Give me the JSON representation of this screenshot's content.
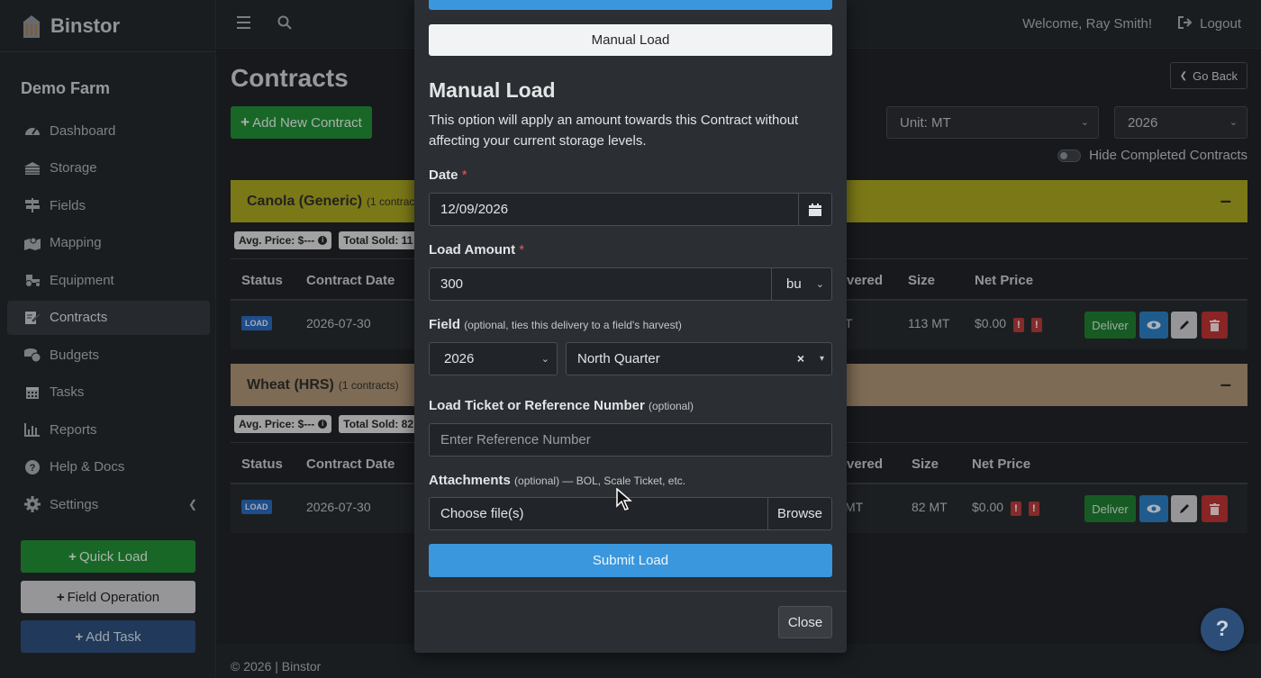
{
  "brand": {
    "name": "Binstor"
  },
  "farm_name": "Demo Farm",
  "sidebar": {
    "items": [
      {
        "label": "Dashboard",
        "icon": "gauge-icon"
      },
      {
        "label": "Storage",
        "icon": "bin-icon"
      },
      {
        "label": "Fields",
        "icon": "sign-icon"
      },
      {
        "label": "Mapping",
        "icon": "map-icon"
      },
      {
        "label": "Equipment",
        "icon": "tractor-icon"
      },
      {
        "label": "Contracts",
        "icon": "contract-icon",
        "active": true
      },
      {
        "label": "Budgets",
        "icon": "coins-icon"
      },
      {
        "label": "Tasks",
        "icon": "calendar-icon"
      },
      {
        "label": "Reports",
        "icon": "chart-icon"
      },
      {
        "label": "Help & Docs",
        "icon": "question-icon"
      },
      {
        "label": "Settings",
        "icon": "gear-icon"
      }
    ],
    "quick_load": "Quick Load",
    "field_operation": "Field Operation",
    "add_task": "Add Task"
  },
  "topbar": {
    "welcome": "Welcome, Ray Smith!",
    "logout": "Logout"
  },
  "main": {
    "title": "Contracts",
    "go_back": "Go Back",
    "add_contract": "Add New Contract",
    "unit_select": "Unit: MT",
    "year_select": "2026",
    "hide_completed": "Hide Completed Contracts"
  },
  "groups": [
    {
      "name": "Canola (Generic)",
      "count": "(1 contract",
      "avg_price": "Avg. Price: $---",
      "total_sold": "Total Sold: 11",
      "headers": {
        "status": "Status",
        "date": "Contract Date",
        "delivered": "vered",
        "size": "Size",
        "net": "Net Price"
      },
      "row": {
        "status": "LOAD",
        "date": "2026-07-30",
        "delivered": "T",
        "size": "113 MT",
        "net": "$0.00"
      }
    },
    {
      "name": "Wheat (HRS)",
      "count": "(1 contracts)",
      "avg_price": "Avg. Price: $---",
      "total_sold": "Total Sold: 82",
      "headers": {
        "status": "Status",
        "date": "Contract Date",
        "delivered": "vered",
        "size": "Size",
        "net": "Net Price"
      },
      "row": {
        "status": "LOAD",
        "date": "2026-07-30",
        "delivered": "MT",
        "size": "82 MT",
        "net": "$0.00"
      }
    }
  ],
  "row_actions": {
    "deliver": "Deliver"
  },
  "footer": "© 2026 | Binstor",
  "help_fab": "?",
  "modal": {
    "manual_load_button": "Manual Load",
    "title": "Manual Load",
    "description": "This option will apply an amount towards this Contract without affecting your current storage levels.",
    "date_label": "Date",
    "date_value": "12/09/2026",
    "load_amount_label": "Load Amount",
    "load_amount_value": "300",
    "unit_value": "bu",
    "field_label": "Field",
    "field_hint": "(optional, ties this delivery to a field's harvest)",
    "field_year": "2026",
    "field_name": "North Quarter",
    "ticket_label": "Load Ticket or Reference Number",
    "ticket_hint": "(optional)",
    "ticket_placeholder": "Enter Reference Number",
    "attachments_label": "Attachments",
    "attachments_hint": "(optional) — BOL, Scale Ticket, etc.",
    "file_placeholder": "Choose file(s)",
    "browse": "Browse",
    "submit": "Submit Load",
    "close": "Close",
    "required_mark": "*"
  },
  "colors": {
    "canola_header": "#a5a120",
    "wheat_header": "#a88f72",
    "primary": "#3a97dd",
    "success": "#218a35",
    "danger": "#b93232"
  }
}
